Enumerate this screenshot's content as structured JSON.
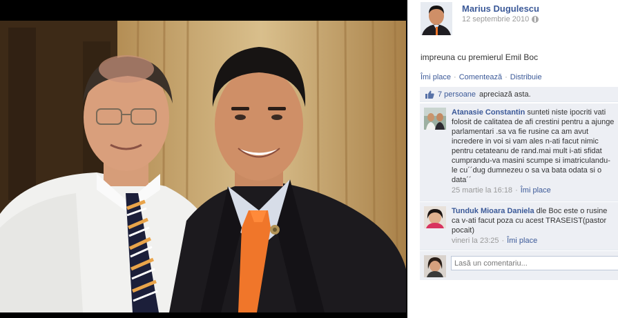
{
  "post": {
    "owner_name": "Marius Dugulescu",
    "date": "12 septembrie 2010",
    "caption": "impreuna cu premierul Emil Boc",
    "actions": {
      "like": "Îmi place",
      "comment": "Comentează",
      "share": "Distribuie",
      "separator": "·"
    }
  },
  "likes": {
    "count": "7 persoane",
    "text": "apreciază asta."
  },
  "comments": [
    {
      "author": "Atanasie Constantin",
      "text": "sunteti niste ipocriti vati folosit de calitatea de afi crestini pentru a ajunge parlamentari .sa va fie rusine ca am avut incredere in voi si vam ales n-ati facut nimic pentru cetateanu de rand.mai mult i-ati sfidat cumprandu-va masini scumpe si imatriculandu-le cu´´dug dumnezeu o sa va bata odata si o data´´",
      "time": "25 martie la 16:18",
      "separator": "·",
      "like": "Îmi place"
    },
    {
      "author": "Tunduk Mioara Daniela",
      "text": "dle Boc este o rusine ca v-ati facut poza cu acest TRASEIST(pastor pocait)",
      "time": "vineri la 23:25",
      "separator": "·",
      "like": "Îmi place"
    }
  ],
  "compose": {
    "placeholder": "Lasă un comentariu..."
  },
  "icons": {
    "privacy": "globe-icon",
    "like": "thumbs-up-icon"
  },
  "colors": {
    "link": "#3b5998",
    "meta": "#999999",
    "comment_bg": "#edeff4",
    "stage_bg": "#000000"
  }
}
